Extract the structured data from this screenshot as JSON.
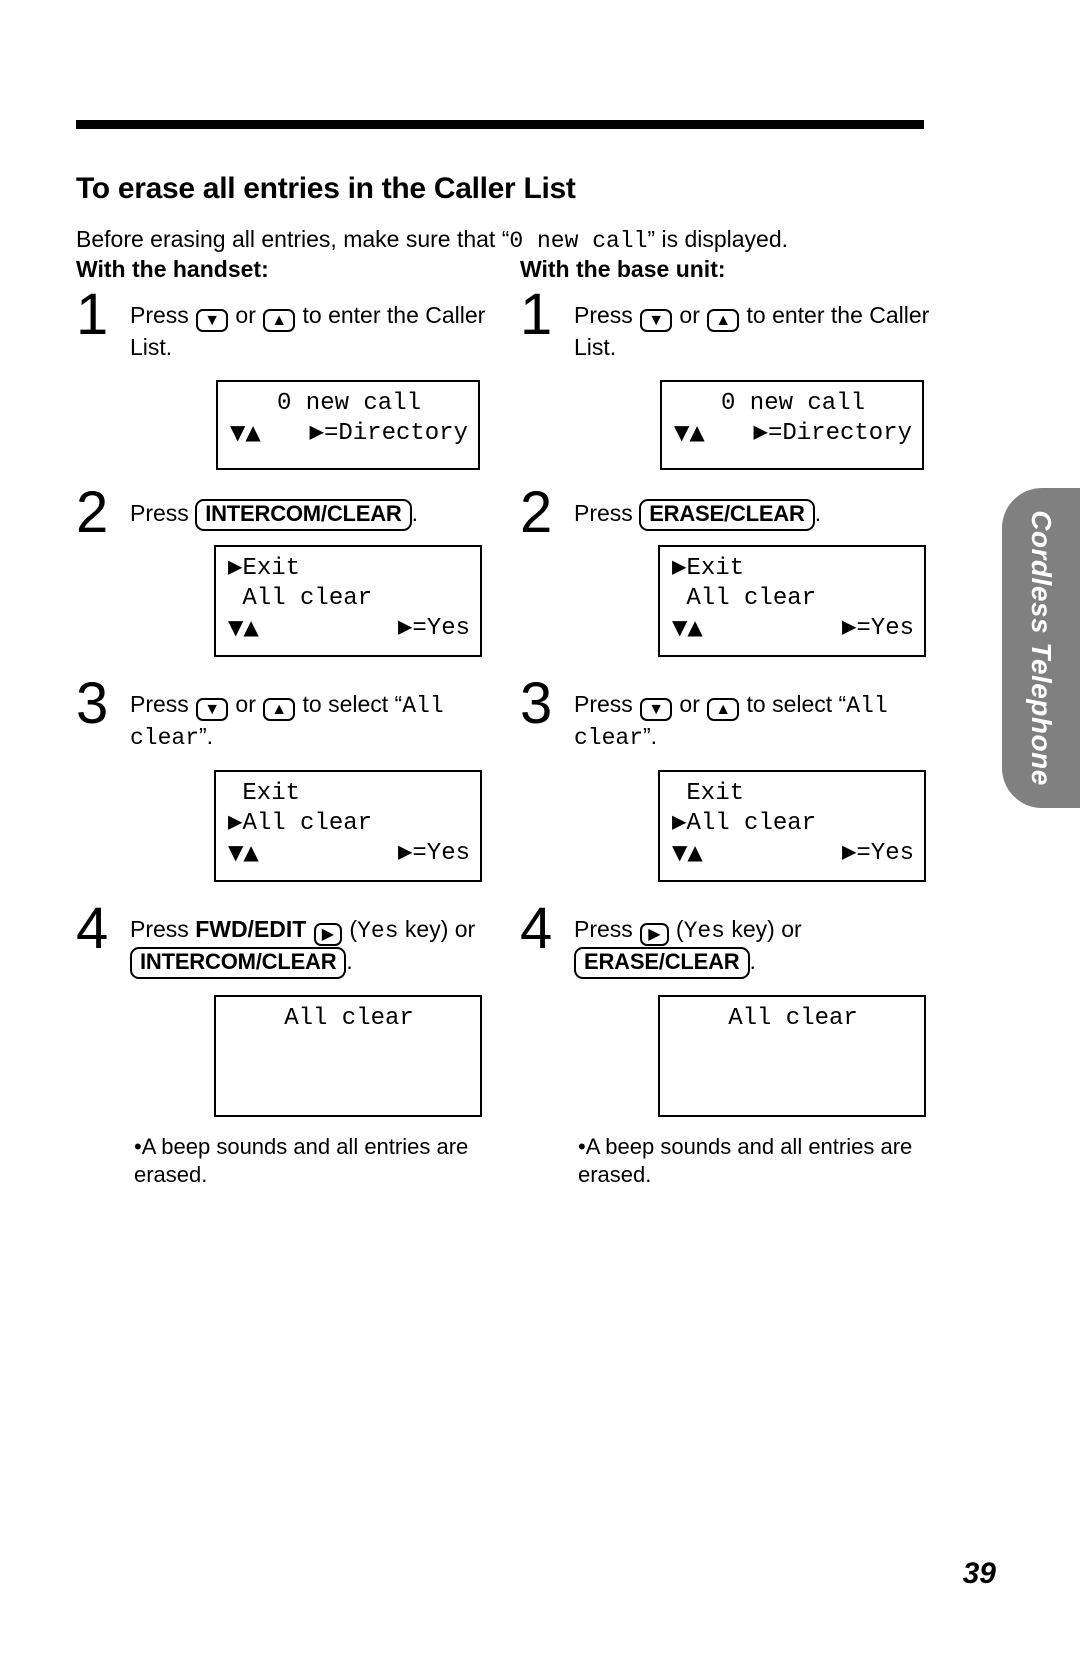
{
  "document": {
    "page_number": "39",
    "side_tab_label": "Cordless Telephone",
    "title": "To erase all entries in the Caller List",
    "intro": {
      "before": "Before erasing all entries, make sure that “",
      "display_text": "0 new call",
      "after": "” is displayed."
    },
    "accent_gray": "#808080",
    "rule_color": "#000000"
  },
  "columns": [
    {
      "heading": "With the handset:",
      "steps": [
        {
          "number": "1",
          "text_parts": {
            "p1": "Press ",
            "key1": "▼",
            "p2": " or ",
            "key2": "▲",
            "p3": " to enter the Caller List."
          },
          "lcd": {
            "line1": "0 new call",
            "line2_left": "▼▲",
            "line2_right": "▶=Directory"
          }
        },
        {
          "number": "2",
          "text_parts": {
            "p1": "Press ",
            "pill": "INTERCOM/CLEAR",
            "p2": "."
          },
          "lcd": {
            "line1": "▶Exit",
            "line2": " All clear",
            "line3_left": "▼▲",
            "line3_right": "▶=Yes"
          }
        },
        {
          "number": "3",
          "text_parts": {
            "p1": "Press ",
            "key1": "▼",
            "p2": " or ",
            "key2": "▲",
            "p3": " to select “",
            "mono": "All clear",
            "p4": "”."
          },
          "lcd": {
            "line1": " Exit",
            "line2": "▶All clear",
            "line3_left": "▼▲",
            "line3_right": "▶=Yes"
          }
        },
        {
          "number": "4",
          "text_parts": {
            "p1": "Press ",
            "bold": "FWD/EDIT",
            "key1": "▶",
            "p2": " (",
            "mono": "Yes",
            "p3": " key) or ",
            "pill": "INTERCOM/CLEAR",
            "p4": "."
          },
          "lcd": {
            "line1": "All clear"
          },
          "note": "A beep sounds and all entries are erased."
        }
      ]
    },
    {
      "heading": "With the base unit:",
      "steps": [
        {
          "number": "1",
          "text_parts": {
            "p1": "Press ",
            "key1": "▼",
            "p2": " or ",
            "key2": "▲",
            "p3": " to enter the Caller List."
          },
          "lcd": {
            "line1": "0 new call",
            "line2_left": "▼▲",
            "line2_right": "▶=Directory"
          }
        },
        {
          "number": "2",
          "text_parts": {
            "p1": "Press ",
            "pill": "ERASE/CLEAR",
            "p2": "."
          },
          "lcd": {
            "line1": "▶Exit",
            "line2": " All clear",
            "line3_left": "▼▲",
            "line3_right": "▶=Yes"
          }
        },
        {
          "number": "3",
          "text_parts": {
            "p1": "Press ",
            "key1": "▼",
            "p2": " or ",
            "key2": "▲",
            "p3": " to select “",
            "mono": "All clear",
            "p4": "”."
          },
          "lcd": {
            "line1": " Exit",
            "line2": "▶All clear",
            "line3_left": "▼▲",
            "line3_right": "▶=Yes"
          }
        },
        {
          "number": "4",
          "text_parts": {
            "p1": "Press ",
            "key1": "▶",
            "p2": " (",
            "mono": "Yes",
            "p3": " key) or ",
            "pill": "ERASE/CLEAR",
            "p4": "."
          },
          "lcd": {
            "line1": "All clear"
          },
          "note": "A beep sounds and all entries are erased."
        }
      ]
    }
  ]
}
